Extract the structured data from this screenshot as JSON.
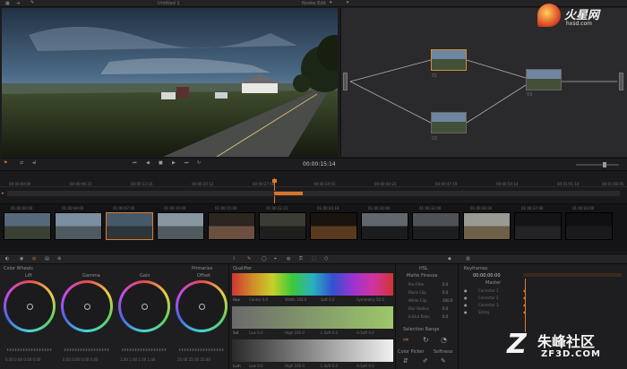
{
  "header": {
    "project_label": "Untitled 1",
    "node_label": "Nodes Edit",
    "corner_label": ""
  },
  "watermark_top": {
    "brand": "火星网",
    "url": "hxsd.com"
  },
  "watermark_bottom": {
    "brand": "朱峰社区",
    "url": "ZF3D.COM"
  },
  "transport": {
    "timecode": "00:00:15:14",
    "buttons": [
      "skip-back-icon",
      "step-back-icon",
      "stop-icon",
      "play-icon",
      "step-forward-icon",
      "loop-icon"
    ]
  },
  "timeline": {
    "ruler": [
      "00:00:00:00",
      "00:00:06:21",
      "00:00:13:16",
      "00:00:20:12",
      "00:00:27:08",
      "00:00:34:03",
      "00:00:40:23",
      "00:00:47:19",
      "00:00:54:14",
      "00:01:01:10",
      "00:01:08:05"
    ]
  },
  "clips": [
    {
      "tc": "01:00:00:00",
      "colors": [
        "#56697a",
        "#3a4034"
      ]
    },
    {
      "tc": "01:00:04:00",
      "colors": [
        "#7c8fa0",
        "#4f5a60"
      ]
    },
    {
      "tc": "01:00:07:00",
      "colors": [
        "#46596a",
        "#2c3538"
      ],
      "selected": true
    },
    {
      "tc": "01:00:10:00",
      "colors": [
        "#8896a2",
        "#505a5e"
      ]
    },
    {
      "tc": "01:00:15:00",
      "colors": [
        "#2c2520",
        "#6b5040"
      ]
    },
    {
      "tc": "01:00:22:21",
      "colors": [
        "#3c3c36",
        "#1e1f1c"
      ]
    },
    {
      "tc": "01:00:24:18",
      "colors": [
        "#1a1410",
        "#5a3a1e"
      ]
    },
    {
      "tc": "01:00:30:00",
      "colors": [
        "#60686e",
        "#1a1c1e"
      ]
    },
    {
      "tc": "01:00:32:00",
      "colors": [
        "#4e5256",
        "#1c1e20"
      ]
    },
    {
      "tc": "01:00:36:04",
      "colors": [
        "#9a9a94",
        "#6e5f48"
      ]
    },
    {
      "tc": "01:00:37:00",
      "colors": [
        "#141416",
        "#232325"
      ]
    },
    {
      "tc": "01:00:43:00",
      "colors": [
        "#101012",
        "#1a1a1c"
      ]
    }
  ],
  "color_wheels": {
    "mode_label": "Color Wheels",
    "tab_label": "Primaries",
    "wheels": [
      {
        "label": "Lift",
        "values": "0.00  0.00  0.00  0.00"
      },
      {
        "label": "Gamma",
        "values": "0.00  0.00  0.00  0.00"
      },
      {
        "label": "Gain",
        "values": "1.00  1.00  1.00  1.00"
      },
      {
        "label": "Offset",
        "values": "25.00  25.00  25.00"
      }
    ]
  },
  "curves": {
    "title": "Qualifier",
    "rows": [
      {
        "name": "Hue",
        "fields": [
          "Center 0.0",
          "Width 100.0",
          "Soft 0.0",
          "Symmetry 50.0"
        ]
      },
      {
        "name": "Sat",
        "fields": [
          "Low 0.0",
          "High 100.0",
          "L.Soft 0.0",
          "H.Soft 0.0"
        ]
      },
      {
        "name": "Lum",
        "fields": [
          "Low 0.0",
          "High 100.0",
          "L.Soft 0.0",
          "H.Soft 0.0"
        ]
      }
    ]
  },
  "matte": {
    "title": "HSL",
    "header": "Matte Finesse",
    "params": [
      {
        "label": "Pre-Filter",
        "value": "0.0"
      },
      {
        "label": "Black Clip",
        "value": "0.0"
      },
      {
        "label": "White Clip",
        "value": "100.0"
      },
      {
        "label": "Blur Radius",
        "value": "0.0"
      },
      {
        "label": "In/Out Ratio",
        "value": "0.0"
      }
    ],
    "section": "Selection Range",
    "picker_label": "Color Picker",
    "softness_label": "Softness"
  },
  "keyframes": {
    "title": "Keyframes",
    "timecode": "00:00:00:00",
    "master": "Master",
    "tracks": [
      "Corrector 1",
      "Corrector 2",
      "Corrector 3",
      "Sizing"
    ]
  }
}
